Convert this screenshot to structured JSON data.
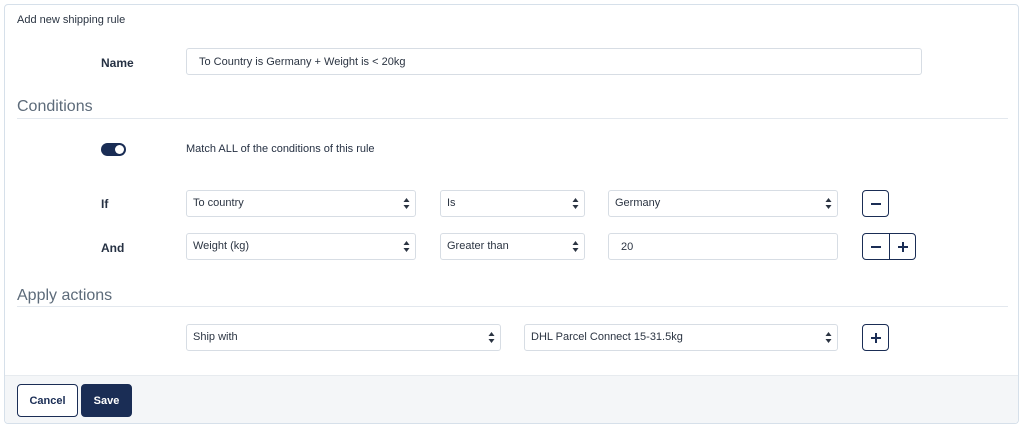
{
  "panel": {
    "title": "Add new shipping rule"
  },
  "name_row": {
    "label": "Name",
    "value": "To Country is Germany + Weight is < 20kg"
  },
  "conditions": {
    "title": "Conditions",
    "match_all_label": "Match ALL of the conditions of this rule",
    "match_all_enabled": true,
    "rows": [
      {
        "label": "If",
        "field": "To country",
        "operator": "Is",
        "value": "Germany",
        "value_type": "select"
      },
      {
        "label": "And",
        "field": "Weight (kg)",
        "operator": "Greater than",
        "value": "20",
        "value_type": "input"
      }
    ]
  },
  "actions": {
    "title": "Apply actions",
    "action": "Ship with",
    "target": "DHL Parcel Connect 15-31.5kg"
  },
  "footer": {
    "cancel_label": "Cancel",
    "save_label": "Save"
  },
  "icons": {
    "remove": "minus-icon",
    "add": "plus-icon",
    "select_caret": "select-caret-icon"
  },
  "colors": {
    "primary": "#1a2d55",
    "border": "#d7dde4",
    "footer_bg": "#f4f6f8"
  }
}
